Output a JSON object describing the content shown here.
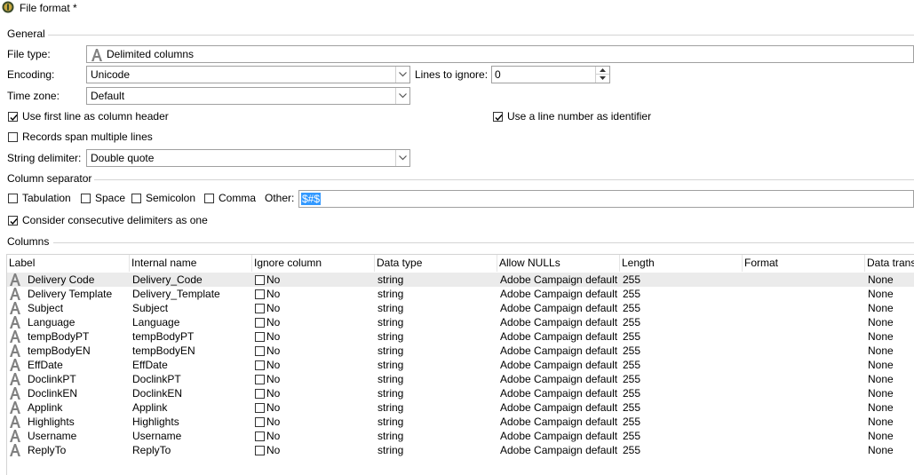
{
  "window": {
    "title": "File format *"
  },
  "general": {
    "section_title": "General",
    "file_type_label": "File type:",
    "file_type_value": "Delimited columns",
    "encoding_label": "Encoding:",
    "encoding_value": "Unicode",
    "lines_to_ignore_label": "Lines to ignore:",
    "lines_to_ignore_value": "0",
    "time_zone_label": "Time zone:",
    "time_zone_value": "Default",
    "use_first_line_label": "Use first line as column header",
    "use_first_line_checked": true,
    "use_line_number_label": "Use a line number as identifier",
    "use_line_number_checked": true,
    "records_span_label": "Records span multiple lines",
    "records_span_checked": false,
    "string_delimiter_label": "String delimiter:",
    "string_delimiter_value": "Double quote"
  },
  "separator": {
    "section_title": "Column separator",
    "tabulation_label": "Tabulation",
    "space_label": "Space",
    "semicolon_label": "Semicolon",
    "comma_label": "Comma",
    "other_label": "Other:",
    "other_value": "$#$",
    "consecutive_label": "Consider consecutive delimiters as one",
    "consecutive_checked": true
  },
  "columns": {
    "section_title": "Columns",
    "headers": [
      "Label",
      "Internal name",
      "Ignore column",
      "Data type",
      "Allow NULLs",
      "Length",
      "Format",
      "Data transf"
    ],
    "rows": [
      {
        "label": "Delivery Code",
        "internal": "Delivery_Code",
        "ignore": "No",
        "type": "string",
        "nulls": "Adobe Campaign default",
        "length": "255",
        "format": "",
        "transform": "None"
      },
      {
        "label": "Delivery Template",
        "internal": "Delivery_Template",
        "ignore": "No",
        "type": "string",
        "nulls": "Adobe Campaign default",
        "length": "255",
        "format": "",
        "transform": "None"
      },
      {
        "label": "Subject",
        "internal": "Subject",
        "ignore": "No",
        "type": "string",
        "nulls": "Adobe Campaign default",
        "length": "255",
        "format": "",
        "transform": "None"
      },
      {
        "label": "Language",
        "internal": "Language",
        "ignore": "No",
        "type": "string",
        "nulls": "Adobe Campaign default",
        "length": "255",
        "format": "",
        "transform": "None"
      },
      {
        "label": "tempBodyPT",
        "internal": "tempBodyPT",
        "ignore": "No",
        "type": "string",
        "nulls": "Adobe Campaign default",
        "length": "255",
        "format": "",
        "transform": "None"
      },
      {
        "label": "tempBodyEN",
        "internal": "tempBodyEN",
        "ignore": "No",
        "type": "string",
        "nulls": "Adobe Campaign default",
        "length": "255",
        "format": "",
        "transform": "None"
      },
      {
        "label": "EffDate",
        "internal": "EffDate",
        "ignore": "No",
        "type": "string",
        "nulls": "Adobe Campaign default",
        "length": "255",
        "format": "",
        "transform": "None"
      },
      {
        "label": "DoclinkPT",
        "internal": "DoclinkPT",
        "ignore": "No",
        "type": "string",
        "nulls": "Adobe Campaign default",
        "length": "255",
        "format": "",
        "transform": "None"
      },
      {
        "label": "DoclinkEN",
        "internal": "DoclinkEN",
        "ignore": "No",
        "type": "string",
        "nulls": "Adobe Campaign default",
        "length": "255",
        "format": "",
        "transform": "None"
      },
      {
        "label": "Applink",
        "internal": "Applink",
        "ignore": "No",
        "type": "string",
        "nulls": "Adobe Campaign default",
        "length": "255",
        "format": "",
        "transform": "None"
      },
      {
        "label": "Highlights",
        "internal": "Highlights",
        "ignore": "No",
        "type": "string",
        "nulls": "Adobe Campaign default",
        "length": "255",
        "format": "",
        "transform": "None"
      },
      {
        "label": "Username",
        "internal": "Username",
        "ignore": "No",
        "type": "string",
        "nulls": "Adobe Campaign default",
        "length": "255",
        "format": "",
        "transform": "None"
      },
      {
        "label": "ReplyTo",
        "internal": "ReplyTo",
        "ignore": "No",
        "type": "string",
        "nulls": "Adobe Campaign default",
        "length": "255",
        "format": "",
        "transform": "None"
      }
    ]
  }
}
